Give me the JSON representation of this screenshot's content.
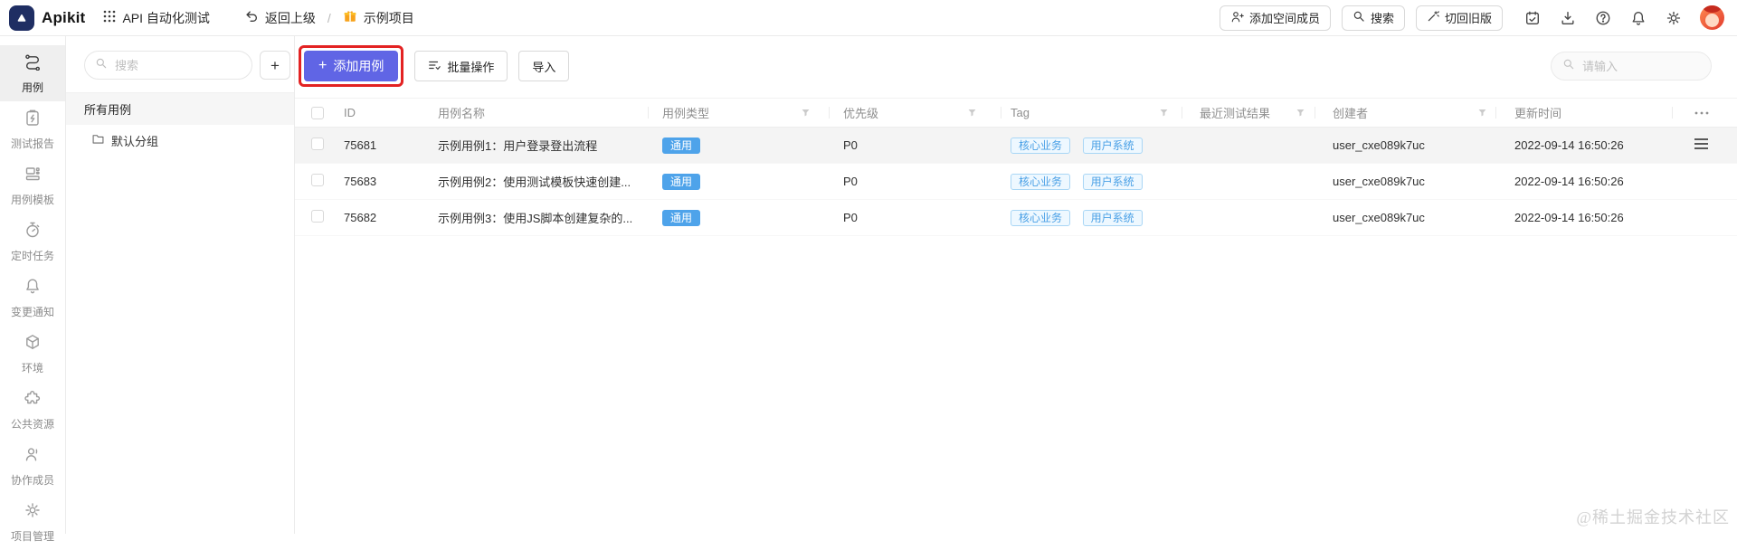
{
  "topbar": {
    "brand": "Apikit",
    "workspace_label": "API 自动化测试",
    "back_label": "返回上级",
    "separator": "/",
    "project_label": "示例项目",
    "add_member_label": "添加空间成员",
    "search_label": "搜索",
    "switch_old_label": "切回旧版"
  },
  "sidebar": {
    "items": [
      {
        "label": "用例",
        "active": true
      },
      {
        "label": "测试报告"
      },
      {
        "label": "用例模板"
      },
      {
        "label": "定时任务"
      },
      {
        "label": "变更通知"
      },
      {
        "label": "环境"
      },
      {
        "label": "公共资源"
      },
      {
        "label": "协作成员"
      },
      {
        "label": "项目管理"
      }
    ]
  },
  "tree": {
    "search_placeholder": "搜索",
    "add_button_label": "+",
    "all_cases_label": "所有用例",
    "default_group_label": "默认分组"
  },
  "toolbar": {
    "add_case_plus": "+",
    "add_case_label": "添加用例",
    "batch_label": "批量操作",
    "import_label": "导入",
    "search_placeholder": "请输入"
  },
  "table": {
    "columns": {
      "id": "ID",
      "name": "用例名称",
      "type": "用例类型",
      "priority": "优先级",
      "tag": "Tag",
      "result": "最近测试结果",
      "creator": "创建者",
      "updated": "更新时间"
    },
    "rows": [
      {
        "id": "75681",
        "name": "示例用例1：用户登录登出流程",
        "type": "通用",
        "priority": "P0",
        "tags": [
          "核心业务",
          "用户系统"
        ],
        "result": "",
        "creator": "user_cxe089k7uc",
        "updated": "2022-09-14 16:50:26"
      },
      {
        "id": "75683",
        "name": "示例用例2：使用测试模板快速创建...",
        "type": "通用",
        "priority": "P0",
        "tags": [
          "核心业务",
          "用户系统"
        ],
        "result": "",
        "creator": "user_cxe089k7uc",
        "updated": "2022-09-14 16:50:26"
      },
      {
        "id": "75682",
        "name": "示例用例3：使用JS脚本创建复杂的...",
        "type": "通用",
        "priority": "P0",
        "tags": [
          "核心业务",
          "用户系统"
        ],
        "result": "",
        "creator": "user_cxe089k7uc",
        "updated": "2022-09-14 16:50:26"
      }
    ]
  },
  "watermark": "@稀土掘金技术社区",
  "colors": {
    "accent": "#6065e5",
    "annotation_red": "#e32222",
    "type_badge_blue": "#4ea3ea",
    "tag_blue": "#4aa0e6",
    "brand_navy": "#1f2e63"
  }
}
